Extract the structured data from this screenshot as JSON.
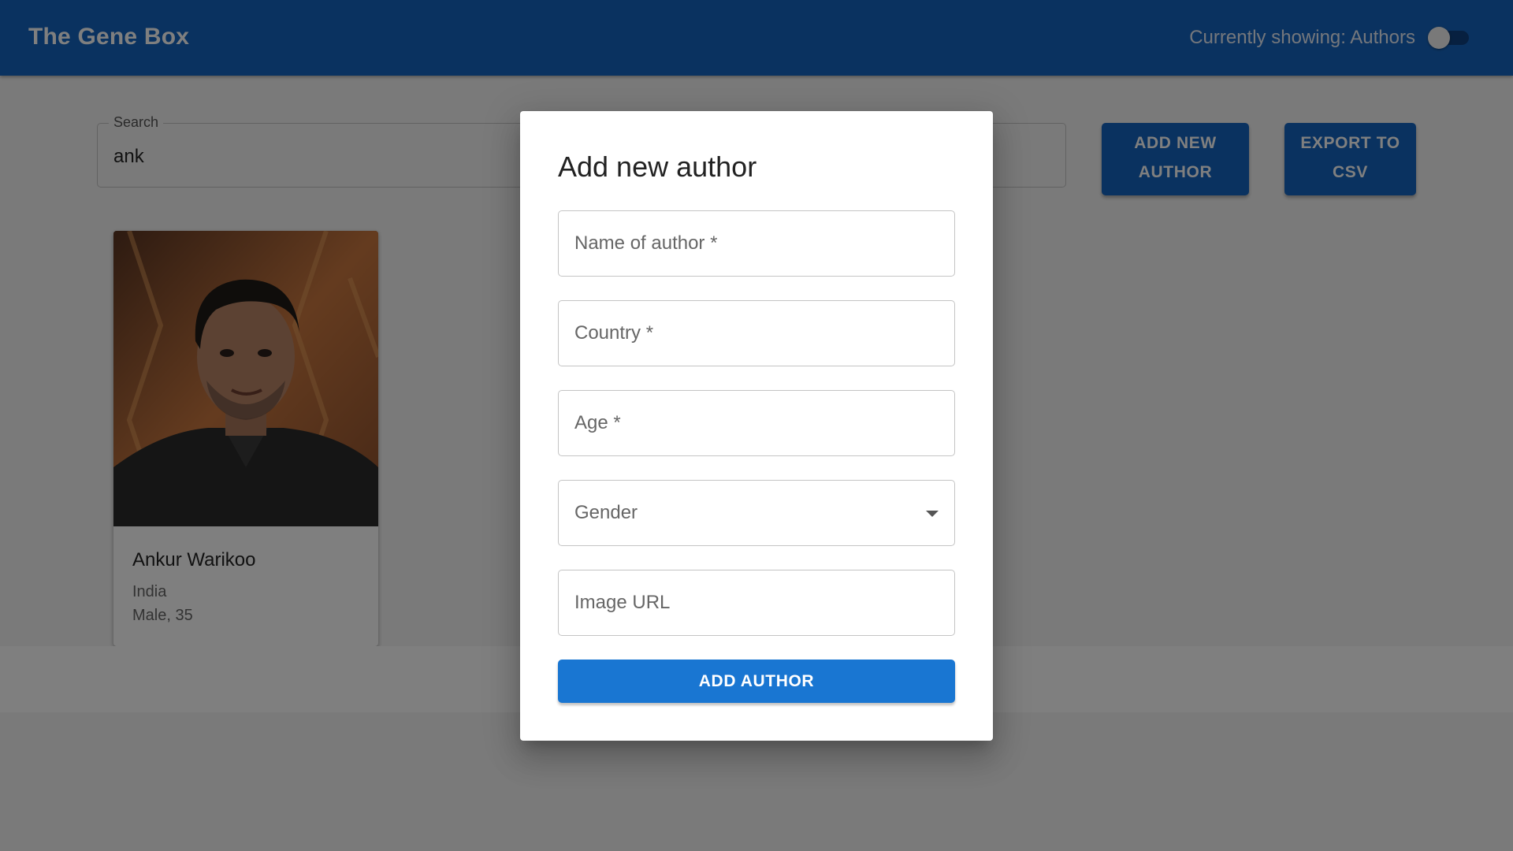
{
  "appbar": {
    "title": "The Gene Box",
    "showing_label": "Currently showing: Authors"
  },
  "search": {
    "label": "Search",
    "value": "ank"
  },
  "actions": {
    "add_new_author_line1": "ADD NEW",
    "add_new_author_line2": "AUTHOR",
    "export_line1": "EXPORT TO",
    "export_line2": "CSV"
  },
  "cards": [
    {
      "name": "Ankur Warikoo",
      "country": "India",
      "meta": "Male, 35"
    }
  ],
  "dialog": {
    "title": "Add new author",
    "fields": {
      "name": "Name of author *",
      "country": "Country *",
      "age": "Age *",
      "gender": "Gender",
      "image_url": "Image URL"
    },
    "submit_label": "ADD AUTHOR"
  },
  "colors": {
    "appbar": "#1565c0",
    "primary_button": "#1976d2"
  }
}
